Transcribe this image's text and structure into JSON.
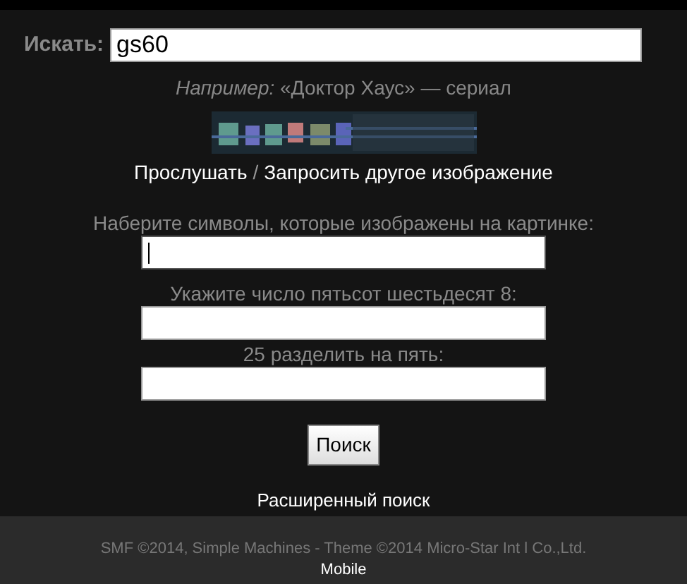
{
  "search": {
    "label": "Искать:",
    "value": "gs60"
  },
  "example": "*Например:* «Доктор Хаус» — сериал",
  "captcha": {
    "kind": "picture",
    "links": [
      {
        "label": "Прослушать"
      },
      {
        "label": "Запросить другое изображение"
      }
    ],
    "separator": "/"
  },
  "verification": [
    {
      "label": "Наберите символы, которые изображены на картинке:",
      "focused": true
    },
    {
      "label": "Укажите число пятьсот шестьдесят 8:",
      "focused": false
    },
    {
      "label": "25 разделить на пять:",
      "focused": false
    }
  ],
  "submit": "Поиск",
  "advanced_link": "Расширенный поиск",
  "footer": {
    "copyright": "SMF ©2014, Simple Machines - Theme ©2014 Micro-Star Int l Co.,Ltd.",
    "mobile_link": "Mobile"
  }
}
